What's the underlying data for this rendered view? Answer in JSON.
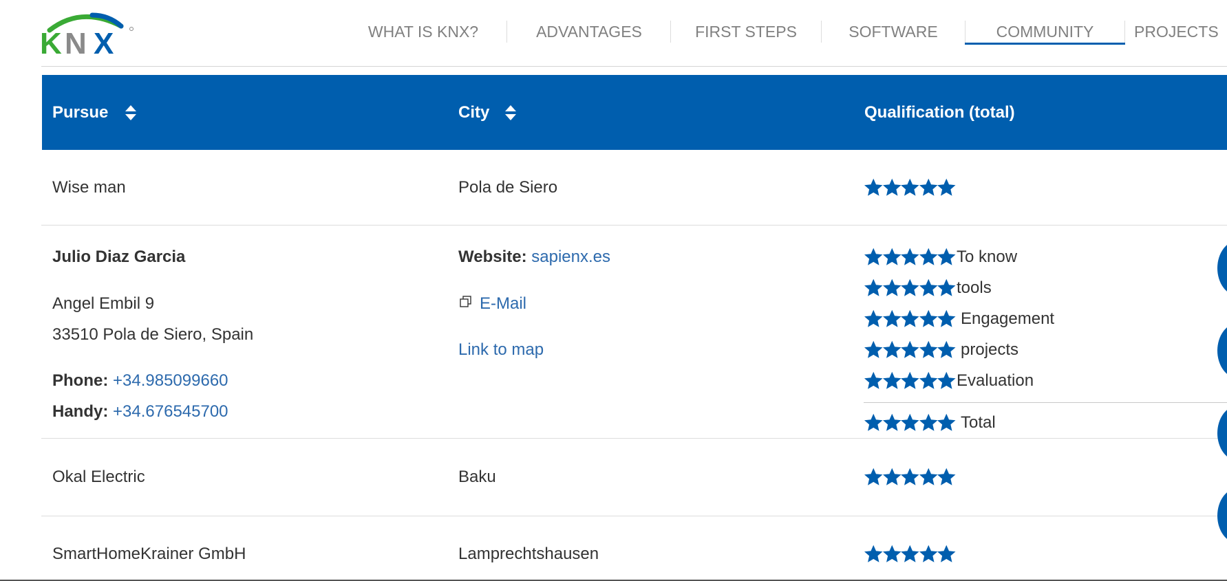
{
  "nav": {
    "items": [
      "WHAT IS KNX?",
      "ADVANTAGES",
      "FIRST STEPS",
      "SOFTWARE",
      "COMMUNITY",
      "PROJECTS"
    ],
    "active": "COMMUNITY"
  },
  "logo": {
    "text": "KNX"
  },
  "table": {
    "headers": {
      "pursue": "Pursue",
      "city": "City",
      "qualification": "Qualification (total)"
    },
    "rows": [
      {
        "name": "Wise man",
        "city": "Pola de Siero",
        "rating": 5
      },
      {
        "name": "Julio Diaz Garcia",
        "street": "Angel Embil 9",
        "postal": "33510 Pola de Siero, Spain",
        "phone_label": "Phone:",
        "phone": "+34.985099660",
        "handy_label": "Handy:",
        "handy": "+34.676545700",
        "website_label": "Website:",
        "website": "sapienx.es",
        "email": "E-Mail",
        "map": "Link to map",
        "ratings": [
          {
            "label": "To know",
            "stars": 5
          },
          {
            "label": "tools",
            "stars": 5
          },
          {
            "label": "Engagement",
            "stars": 5
          },
          {
            "label": "projects",
            "stars": 5
          },
          {
            "label": "Evaluation",
            "stars": 5
          }
        ],
        "total_label": "Total",
        "total_stars": 5
      },
      {
        "name": "Okal Electric",
        "city": "Baku",
        "rating": 5
      },
      {
        "name": "SmartHomeKrainer GmbH",
        "city": "Lamprechtshausen",
        "rating": 5
      }
    ]
  },
  "colors": {
    "brand_blue": "#005eae",
    "link_blue": "#2d6aad",
    "nav_gray": "#808080",
    "logo_green": "#3aaa35",
    "logo_gray": "#8a8a8a"
  },
  "icons": [
    "sort-icon",
    "star-icon",
    "external-link-icon"
  ]
}
